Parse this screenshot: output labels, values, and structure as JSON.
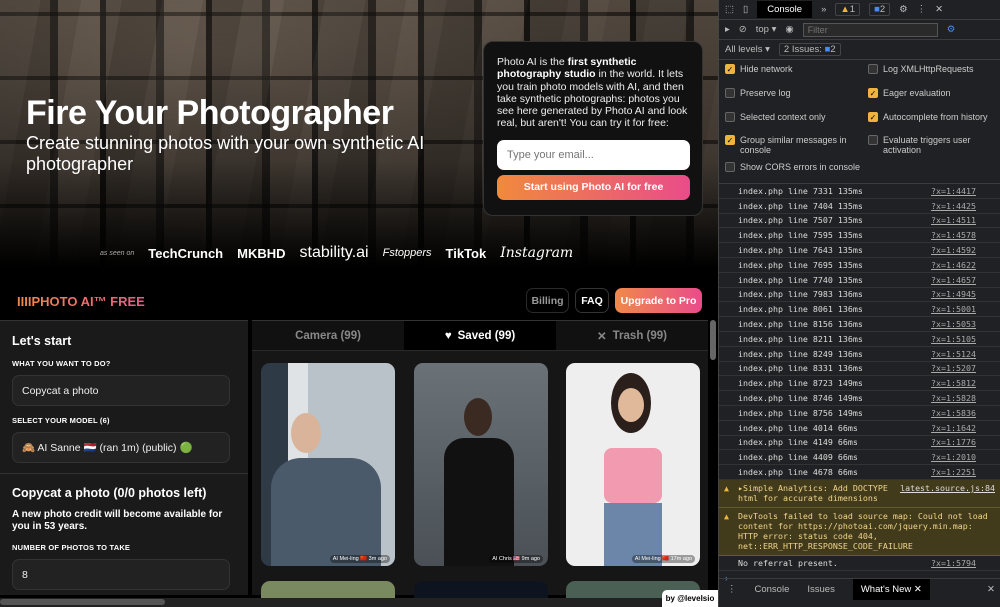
{
  "hero": {
    "title": "Fire Your Photographer",
    "subtitle": "Create stunning photos with your own synthetic AI photographer",
    "signup": {
      "text_pre": "Photo AI is the ",
      "text_bold": "first synthetic photography studio",
      "text_post": " in the world. It lets you train photo models with AI, and then take synthetic photographs: photos you see here generated by Photo AI and look real, but aren't! You can try it for free:",
      "email_placeholder": "Type your email...",
      "cta": "Start using Photo AI for free"
    },
    "as_seen_on": "as seen on",
    "press": [
      "TechCrunch",
      "MKBHD",
      "stability.ai",
      "Fstoppers",
      "TikTok",
      "Instagram"
    ]
  },
  "nav": {
    "logo": "IIIIPHOTO AI™ FREE",
    "billing": "Billing",
    "faq": "FAQ",
    "upgrade": "Upgrade to Pro"
  },
  "sidebar": {
    "heading": "Let's start",
    "what_label": "WHAT YOU WANT TO DO?",
    "what_value": "Copycat a photo",
    "model_label": "SELECT YOUR MODEL (6)",
    "model_value": "🙈 AI Sanne 🇳🇱 (ran 1m) (public) 🟢",
    "section": "Copycat a photo (0/0 photos left)",
    "credit_note": "A new photo credit will become available for you in 53 years.",
    "num_label": "NUMBER OF PHOTOS TO TAKE",
    "num_value": "8"
  },
  "gallery": {
    "tabs": [
      {
        "label": "Camera (99)"
      },
      {
        "icon": "♥",
        "label": "Saved (99)"
      },
      {
        "icon": "✕",
        "label": "Trash (99)"
      }
    ],
    "photos": [
      {
        "caption": "AI Mei-ling 🇨🇳 3m ago"
      },
      {
        "caption": "AI Chris 🇺🇸 9m ago"
      },
      {
        "caption": "AI Mei-ling 🇨🇳 17m ago"
      }
    ]
  },
  "byline": "by @levelsio",
  "devtools": {
    "tab": "Console",
    "warn_count": "1",
    "issue_count": "2",
    "context": "top",
    "filter_placeholder": "Filter",
    "levels": "All levels",
    "issues": "2 Issues:",
    "issues_n": "2",
    "options": [
      {
        "label": "Hide network",
        "on": true
      },
      {
        "label": "Log XMLHttpRequests",
        "on": false
      },
      {
        "label": "Preserve log",
        "on": false
      },
      {
        "label": "Eager evaluation",
        "on": true
      },
      {
        "label": "Selected context only",
        "on": false
      },
      {
        "label": "Autocomplete from history",
        "on": true
      },
      {
        "label": "Group similar messages in console",
        "on": true
      },
      {
        "label": "Evaluate triggers user activation",
        "on": false
      },
      {
        "label": "Show CORS errors in console",
        "on": false
      }
    ],
    "logs": [
      [
        "index.php line 7331 135ms",
        "?x=1:4417"
      ],
      [
        "index.php line 7404 135ms",
        "?x=1:4425"
      ],
      [
        "index.php line 7507 135ms",
        "?x=1:4511"
      ],
      [
        "index.php line 7595 135ms",
        "?x=1:4578"
      ],
      [
        "index.php line 7643 135ms",
        "?x=1:4592"
      ],
      [
        "index.php line 7695 135ms",
        "?x=1:4622"
      ],
      [
        "index.php line 7740 135ms",
        "?x=1:4657"
      ],
      [
        "index.php line 7983 136ms",
        "?x=1:4945"
      ],
      [
        "index.php line 8061 136ms",
        "?x=1:5001"
      ],
      [
        "index.php line 8156 136ms",
        "?x=1:5053"
      ],
      [
        "index.php line 8211 136ms",
        "?x=1:5105"
      ],
      [
        "index.php line 8249 136ms",
        "?x=1:5124"
      ],
      [
        "index.php line 8331 136ms",
        "?x=1:5207"
      ],
      [
        "index.php line 8723 149ms",
        "?x=1:5812"
      ],
      [
        "index.php line 8746 149ms",
        "?x=1:5828"
      ],
      [
        "index.php line 8756 149ms",
        "?x=1:5836"
      ],
      [
        "index.php line 4014 66ms",
        "?x=1:1642"
      ],
      [
        "index.php line 4149 66ms",
        "?x=1:1776"
      ],
      [
        "index.php line 4409 66ms",
        "?x=1:2010"
      ],
      [
        "index.php line 4678 66ms",
        "?x=1:2251"
      ]
    ],
    "warn1": {
      "text": "▸Simple Analytics:  Add DOCTYPE html for accurate dimensions",
      "src": "latest.source.js:84"
    },
    "warn2": {
      "text": "DevTools failed to load source map: Could not load content for https://photoai.com/jquery.min.map: HTTP error: status code 404, net::ERR_HTTP_RESPONSE_CODE_FAILURE"
    },
    "log_last": [
      "No referral present.",
      "?x=1:5794"
    ],
    "drawer_tabs": [
      "Console",
      "Issues",
      "What's New"
    ]
  }
}
